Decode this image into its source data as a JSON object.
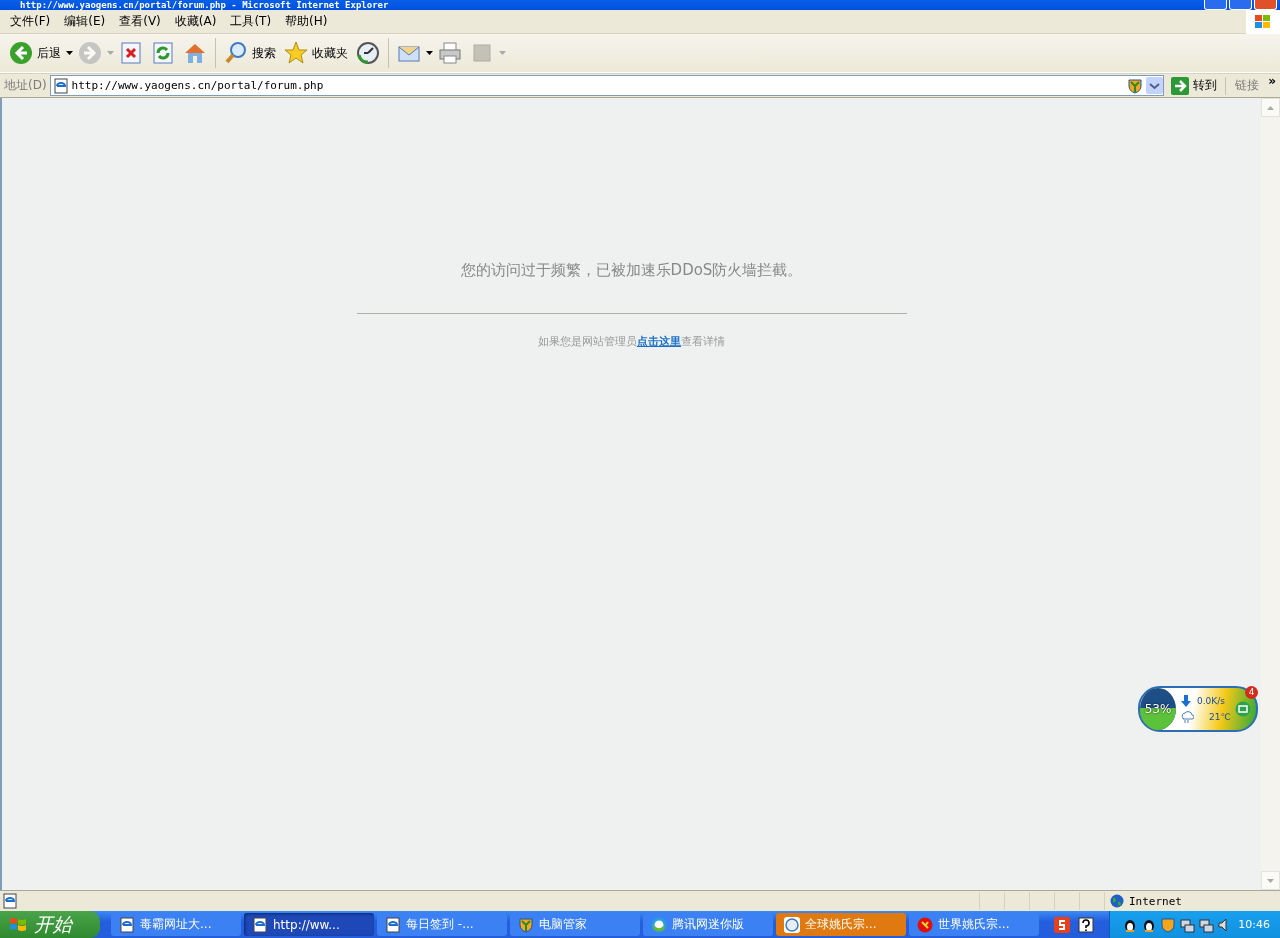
{
  "window": {
    "title": "http://www.yaogens.cn/portal/forum.php - Microsoft Internet Explorer"
  },
  "menu": [
    {
      "label": "文件(F)"
    },
    {
      "label": "编辑(E)"
    },
    {
      "label": "查看(V)"
    },
    {
      "label": "收藏(A)"
    },
    {
      "label": "工具(T)"
    },
    {
      "label": "帮助(H)"
    }
  ],
  "toolbar": [
    {
      "kind": "back",
      "label": "后退",
      "dropdown": true,
      "disabled": false
    },
    {
      "kind": "forward",
      "dropdown": true,
      "disabled": true
    },
    {
      "kind": "stop",
      "dropdown": false,
      "disabled": false
    },
    {
      "kind": "refresh",
      "dropdown": false,
      "disabled": false
    },
    {
      "kind": "home",
      "dropdown": false,
      "disabled": false
    },
    {
      "kind": "separator"
    },
    {
      "kind": "search",
      "label": "搜索",
      "dropdown": false,
      "disabled": false
    },
    {
      "kind": "favorites",
      "label": "收藏夹",
      "dropdown": false,
      "disabled": false
    },
    {
      "kind": "history",
      "dropdown": false,
      "disabled": false
    },
    {
      "kind": "separator"
    },
    {
      "kind": "mail",
      "dropdown": true,
      "disabled": false
    },
    {
      "kind": "print",
      "dropdown": false,
      "disabled": false
    },
    {
      "kind": "blank",
      "dropdown": true,
      "disabled": true
    }
  ],
  "address_bar": {
    "label": "地址(D)",
    "value": "http://www.yaogens.cn/portal/forum.php",
    "go": "转到",
    "links": "链接",
    "more": "»"
  },
  "page": {
    "message": "您的访问过于频繁，已被加速乐DDoS防火墙拦截。",
    "note_before": "如果您是网站管理员",
    "link": "点击这里",
    "note_after": "查看详情"
  },
  "widget": {
    "level": 0.53,
    "reading": "53%",
    "speed": "0.0K/s",
    "temperature": "21℃",
    "badge": "4"
  },
  "status_bar": {
    "zone": "Internet"
  },
  "taskbar": {
    "start": "开始",
    "tasks": [
      {
        "label": "毒霸网址大...",
        "kind": "ie",
        "selected": false,
        "flashing": false
      },
      {
        "label": "http://ww...",
        "kind": "ie",
        "selected": true,
        "flashing": false
      },
      {
        "label": "每日签到 -...",
        "kind": "ie",
        "selected": false,
        "flashing": false
      },
      {
        "label": "电脑管家",
        "kind": "shield",
        "selected": false,
        "flashing": false
      },
      {
        "label": "腾讯网迷你版",
        "kind": "ring",
        "selected": false,
        "flashing": false
      },
      {
        "label": "全球姚氏宗...",
        "kind": "badge",
        "selected": false,
        "flashing": true
      },
      {
        "label": "世界姚氏宗...",
        "kind": "logo",
        "selected": false,
        "flashing": false
      }
    ],
    "clock": "10:46"
  }
}
